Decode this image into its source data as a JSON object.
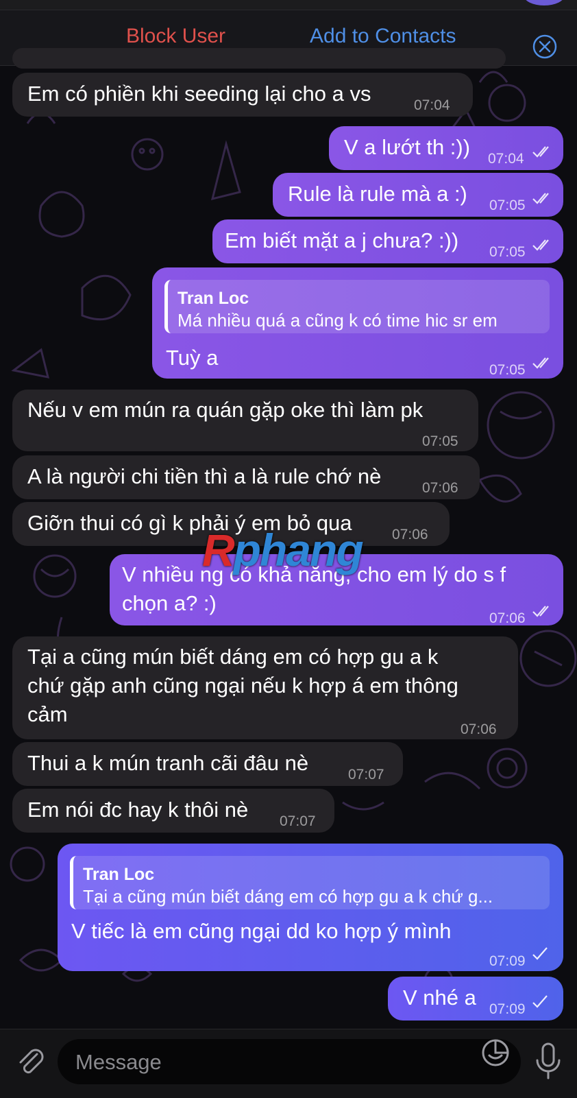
{
  "header": {
    "block_label": "Block User",
    "add_label": "Add to Contacts"
  },
  "messages": [
    {
      "text": "Em có phiền khi seeding lại cho a vs",
      "time": "07:04"
    },
    {
      "text": "V a lướt th :))",
      "time": "07:04"
    },
    {
      "text": "Rule là rule mà a :)",
      "time": "07:05"
    },
    {
      "text": "Em biết mặt a j chưa? :))",
      "time": "07:05"
    },
    {
      "reply_name": "Tran Loc",
      "reply_text": "Má nhiều quá a cũng k có time hic sr em",
      "text": "Tuỳ a",
      "time": "07:05"
    },
    {
      "text": "Nếu v em mún ra quán gặp oke thì làm pk",
      "time": "07:05"
    },
    {
      "text": "A là người chi tiền thì a là rule chớ nè",
      "time": "07:06"
    },
    {
      "text": "Giỡn thui có gì k phải ý em bỏ qua",
      "time": "07:06"
    },
    {
      "line1": "V nhiều ng có khả năng, cho em lý do s f",
      "line2": "chọn a? :)",
      "time": "07:06"
    },
    {
      "line1": "Tại a cũng mún biết dáng em có hợp gu a k",
      "line2": "chứ gặp anh cũng ngại nếu k hợp á em thông",
      "line3": "cảm",
      "time": "07:06"
    },
    {
      "text": "Thui a k mún tranh cãi đâu nè",
      "time": "07:07"
    },
    {
      "text": "Em nói đc hay k thôi nè",
      "time": "07:07"
    },
    {
      "reply_name": "Tran Loc",
      "reply_text": "Tại a cũng mún biết dáng em có hợp gu a k chứ g...",
      "text": "V tiếc là em cũng ngại dd ko hợp ý mình",
      "time": "07:09"
    },
    {
      "text": "V nhé a",
      "time": "07:09"
    }
  ],
  "watermark": {
    "first": "R",
    "rest": "phang"
  },
  "input": {
    "placeholder": "Message"
  }
}
